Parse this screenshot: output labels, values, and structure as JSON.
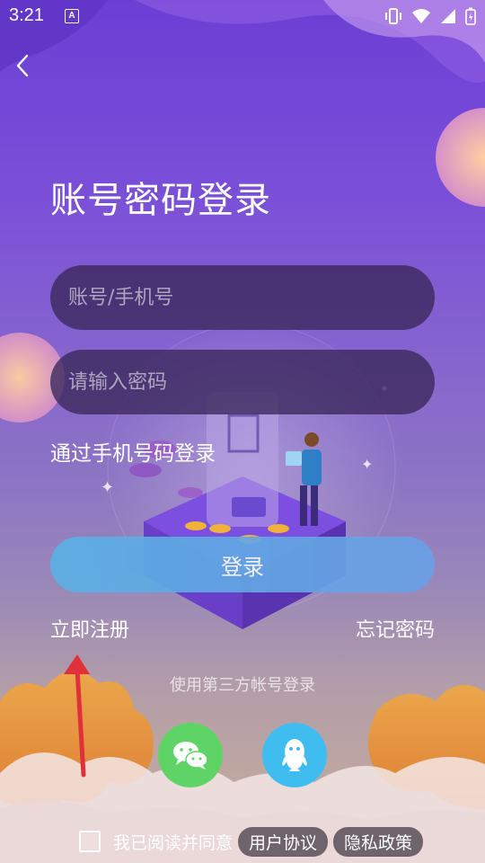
{
  "status_bar": {
    "time": "3:21",
    "indicator": "A"
  },
  "header": {
    "title": "账号密码登录",
    "back_icon": "chevron-left-icon"
  },
  "form": {
    "account_placeholder": "账号/手机号",
    "account_value": "",
    "password_placeholder": "请输入密码",
    "password_value": "",
    "phone_login_label": "通过手机号码登录",
    "login_button_label": "登录"
  },
  "links": {
    "register_label": "立即注册",
    "forgot_label": "忘记密码"
  },
  "third_party": {
    "label": "使用第三方帐号登录",
    "providers": [
      {
        "name": "wechat",
        "icon": "wechat-icon",
        "color": "#5ed466"
      },
      {
        "name": "qq",
        "icon": "qq-icon",
        "color": "#3fbdf0"
      }
    ]
  },
  "agreement": {
    "checked": false,
    "text": "我已阅读并同意",
    "user_agreement_label": "用户协议",
    "privacy_policy_label": "隐私政策"
  },
  "colors": {
    "accent": "#6a9fe6",
    "background_top": "#6b3fd4",
    "wechat": "#5ed466",
    "qq": "#3fbdf0"
  }
}
